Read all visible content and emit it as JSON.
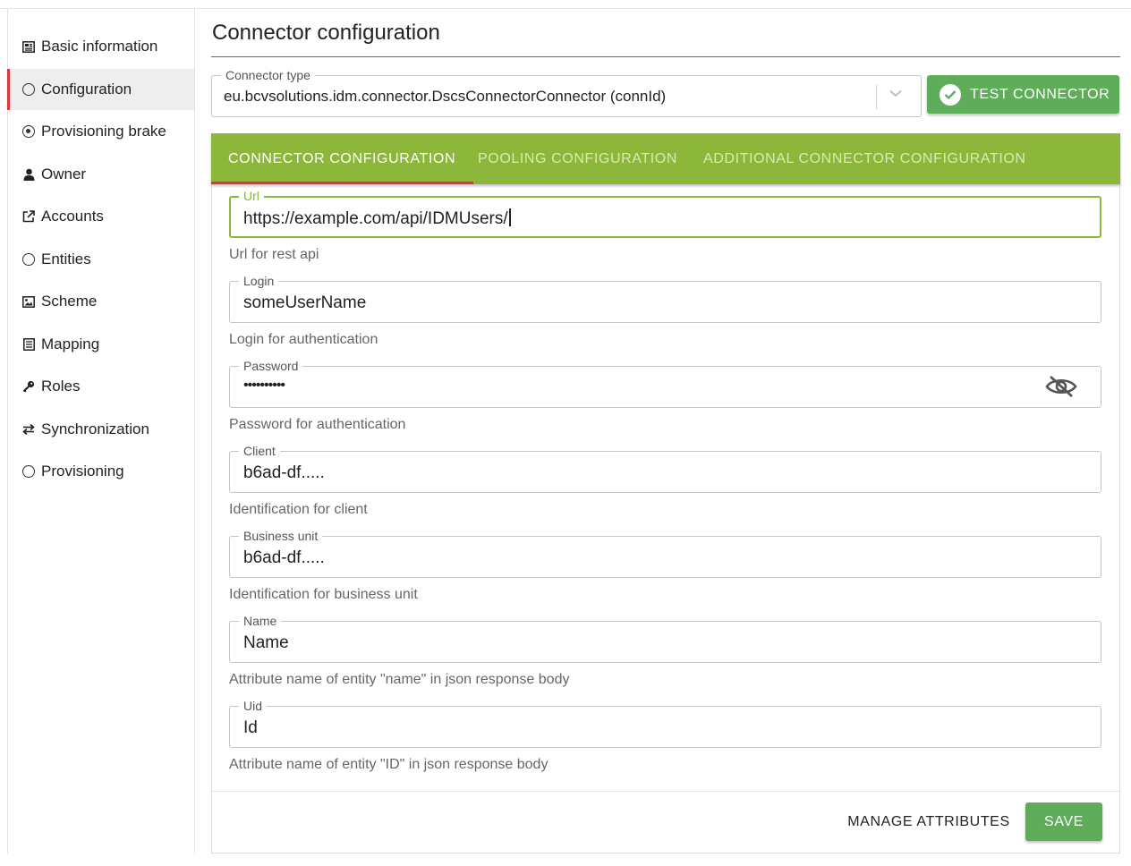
{
  "sidebar": {
    "items": [
      {
        "label": "Basic information",
        "icon": "newspaper-icon"
      },
      {
        "label": "Configuration",
        "icon": "circle-outline-icon",
        "active": true
      },
      {
        "label": "Provisioning brake",
        "icon": "dot-circle-icon"
      },
      {
        "label": "Owner",
        "icon": "user-icon"
      },
      {
        "label": "Accounts",
        "icon": "external-link-icon"
      },
      {
        "label": "Entities",
        "icon": "circle-outline-icon"
      },
      {
        "label": "Scheme",
        "icon": "image-icon"
      },
      {
        "label": "Mapping",
        "icon": "list-alt-icon"
      },
      {
        "label": "Roles",
        "icon": "key-icon"
      },
      {
        "label": "Synchronization",
        "icon": "exchange-icon"
      },
      {
        "label": "Provisioning",
        "icon": "circle-outline-icon"
      }
    ]
  },
  "main": {
    "title": "Connector configuration",
    "connector_type": {
      "label": "Connector type",
      "value": "eu.bcvsolutions.idm.connector.DscsConnectorConnector (connId)"
    },
    "test_button": "TEST CONNECTOR",
    "tabs": [
      {
        "label": "CONNECTOR CONFIGURATION",
        "active": true
      },
      {
        "label": "POOLING CONFIGURATION"
      },
      {
        "label": "ADDITIONAL CONNECTOR CONFIGURATION"
      }
    ],
    "fields": {
      "url": {
        "label": "Url",
        "value": "https://example.com/api/IDMUsers/",
        "help": "Url for rest api"
      },
      "login": {
        "label": "Login",
        "value": "someUserName",
        "help": "Login for authentication"
      },
      "password": {
        "label": "Password",
        "value": "••••••••••",
        "help": "Password for authentication"
      },
      "client": {
        "label": "Client",
        "value": "b6ad-df.....",
        "help": "Identification for client"
      },
      "business_unit": {
        "label": "Business unit",
        "value": "b6ad-df.....",
        "help": "Identification for business unit"
      },
      "name": {
        "label": "Name",
        "value": "Name",
        "help": "Attribute name of entity \"name\" in json response body"
      },
      "uid": {
        "label": "Uid",
        "value": "Id",
        "help": "Attribute name of entity \"ID\" in json response body"
      }
    },
    "manage_button": "MANAGE ATTRIBUTES",
    "save_button": "SAVE"
  },
  "colors": {
    "accent_green": "#8db73a",
    "button_green": "#5fac5b",
    "accent_red": "#e0333d"
  }
}
